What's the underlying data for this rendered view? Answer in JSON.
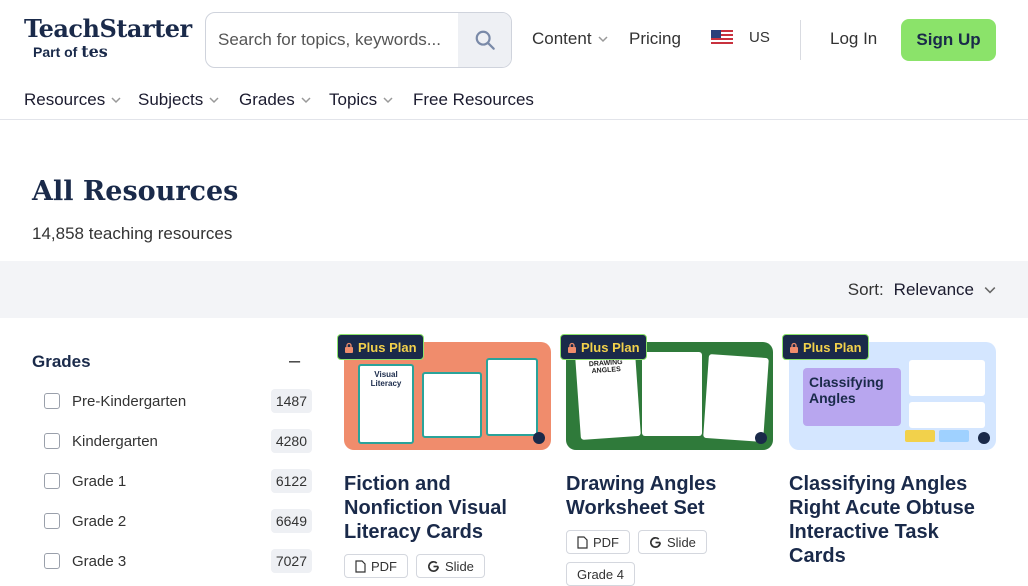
{
  "brand": {
    "name": "TeachStarter",
    "sub_prefix": "Part of",
    "sub_brand": "tes"
  },
  "search": {
    "placeholder": "Search for topics, keywords..."
  },
  "topnav": {
    "content": "Content",
    "pricing": "Pricing",
    "region": "US",
    "login": "Log In",
    "signup": "Sign Up"
  },
  "subnav": {
    "items": [
      "Resources",
      "Subjects",
      "Grades",
      "Topics",
      "Free Resources"
    ]
  },
  "page": {
    "title": "All Resources",
    "count": "14,858 teaching resources"
  },
  "sort": {
    "label": "Sort:",
    "value": "Relevance"
  },
  "filters": {
    "title": "Grades",
    "collapse": "–",
    "items": [
      {
        "label": "Pre-Kindergarten",
        "count": "1487"
      },
      {
        "label": "Kindergarten",
        "count": "4280"
      },
      {
        "label": "Grade 1",
        "count": "6122"
      },
      {
        "label": "Grade 2",
        "count": "6649"
      },
      {
        "label": "Grade 3",
        "count": "7027"
      }
    ]
  },
  "cards": [
    {
      "badge": "Plus Plan",
      "title": "Fiction and Nonfiction Visual Literacy Cards",
      "thumb_text": "Visual Literacy",
      "tags": [
        "PDF",
        "Slide"
      ],
      "thumb_color": "#f08c6c"
    },
    {
      "badge": "Plus Plan",
      "title": "Drawing Angles Worksheet Set",
      "thumb_text": "DRAWING ANGLES",
      "tags": [
        "PDF",
        "Slide",
        "Grade 4"
      ],
      "thumb_color": "#2f7a3a"
    },
    {
      "badge": "Plus Plan",
      "title": "Classifying Angles Right Acute Obtuse Interactive Task Cards",
      "thumb_text": "Classifying Angles",
      "tags": [],
      "thumb_color": "#cfe3ff"
    }
  ]
}
